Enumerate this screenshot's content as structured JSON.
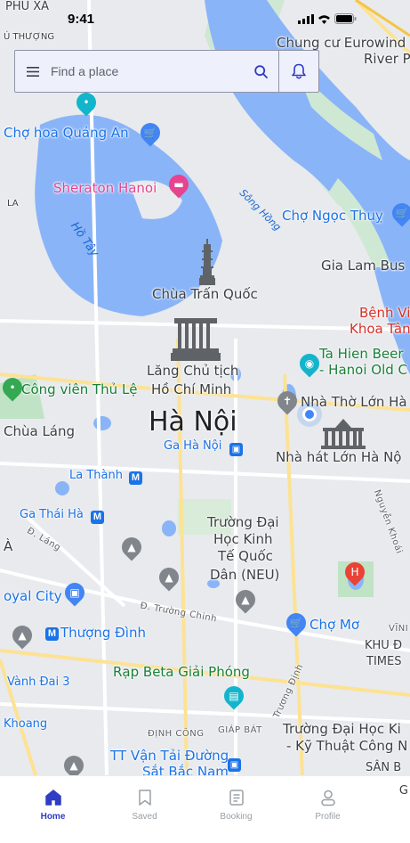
{
  "status_bar": {
    "time": "9:41"
  },
  "search": {
    "placeholder": "Find a place"
  },
  "map_labels": {
    "phu_xa": "PHÚ XÁ",
    "tu_thuong": "Ú THƯỢNG",
    "chung_cu": "Chung cư Eurowind",
    "river_p": "River P",
    "cho_hoa": "Chợ hoa Quảng An",
    "sheraton": "Sheraton Hanoi",
    "la": "LA",
    "ho_tay": "Hồ Tây",
    "song_hong": "Sông Hồng",
    "cho_ngoc_thuy": "Chợ Ngọc Thuỵ",
    "gia_lam": "Gia Lam Bus",
    "chua_tran_quoc": "Chùa Trấn Quốc",
    "benh_vien": "Bệnh Vi",
    "khoa_tan": "Khoa Tân",
    "lang_1": "Lăng Chủ tịch",
    "lang_2": "Hồ Chí Minh",
    "ta_hien_1": "Ta Hien Beer",
    "ta_hien_2": "- Hanoi Old C",
    "cong_vien": "Công viên Thủ Lệ",
    "nha_tho": "Nhà Thờ Lớn Hà",
    "chua_lang": "Chùa Láng",
    "ha_noi": "Hà Nội",
    "ga_ha_noi": "Ga Hà Nội",
    "nha_hat": "Nhà hát Lớn Hà Nộ",
    "la_thanh": "La Thành",
    "ga_thai_ha": "Ga Thái Hà",
    "nguyen_khoai": "Nguyễn Khoái",
    "truong_dai_1": "Trường Đại",
    "truong_dai_2": "Học Kinh",
    "truong_dai_3": "Tế Quốc",
    "truong_dai_4": "Dân (NEU)",
    "a": "À",
    "d_lang": "Đ. Láng",
    "royal_city": "oyal City",
    "truong_chinh": "Đ. Trường Chinh",
    "cho_mo": "Chợ Mơ",
    "vinh": "VĨNI",
    "thuong_dinh": "Thượng Đình",
    "khu_d": "KHU Đ",
    "times": "TIMES",
    "rap_beta": "Rạp Beta Giải Phóng",
    "vanh_dai": "Vành Đai 3",
    "truong_dinh": "Trương Định",
    "khoang": "Khoang",
    "dinh_cong": "ĐỊNH CÔNG",
    "giap_bat": "GIÁP BÁT",
    "truong_dh_1": "Trường Đại Học Ki",
    "truong_dh_2": "- Kỹ Thuật Công N",
    "tt_van_tai_1": "TT Vận Tải Đường",
    "tt_van_tai_2": "Sắt Bắc Nam",
    "san_b": "SÂN B",
    "g": "G"
  },
  "nav": {
    "items": [
      {
        "label": "Home",
        "icon": "home-icon",
        "active": true
      },
      {
        "label": "Saved",
        "icon": "bookmark-icon",
        "active": false
      },
      {
        "label": "Booking",
        "icon": "receipt-icon",
        "active": false
      },
      {
        "label": "Profile",
        "icon": "person-icon",
        "active": false
      }
    ]
  },
  "colors": {
    "accent": "#2f3cc4",
    "water": "#8ab4f8",
    "park": "#b8e2bc",
    "road_major": "#fde293"
  }
}
